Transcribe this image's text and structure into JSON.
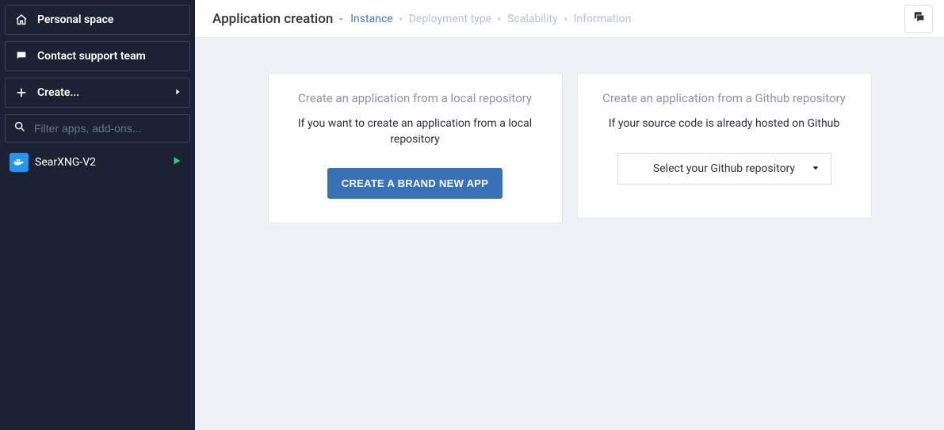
{
  "sidebar": {
    "personal_space": "Personal space",
    "contact_support": "Contact support team",
    "create": "Create...",
    "filter_placeholder": "Filter apps, add-ons...",
    "apps": [
      {
        "name": "SearXNG-V2"
      }
    ]
  },
  "header": {
    "title": "Application creation",
    "breadcrumbs": [
      {
        "label": "Instance",
        "active": true
      },
      {
        "label": "Deployment type",
        "active": false
      },
      {
        "label": "Scalability",
        "active": false
      },
      {
        "label": "Information",
        "active": false
      }
    ]
  },
  "cards": {
    "local": {
      "title": "Create an application from a local repository",
      "desc": "If you want to create an application from a local repository",
      "button": "Create a brand new app"
    },
    "github": {
      "title": "Create an application from a Github repository",
      "desc": "If your source code is already hosted on Github",
      "select_label": "Select your Github repository"
    }
  }
}
